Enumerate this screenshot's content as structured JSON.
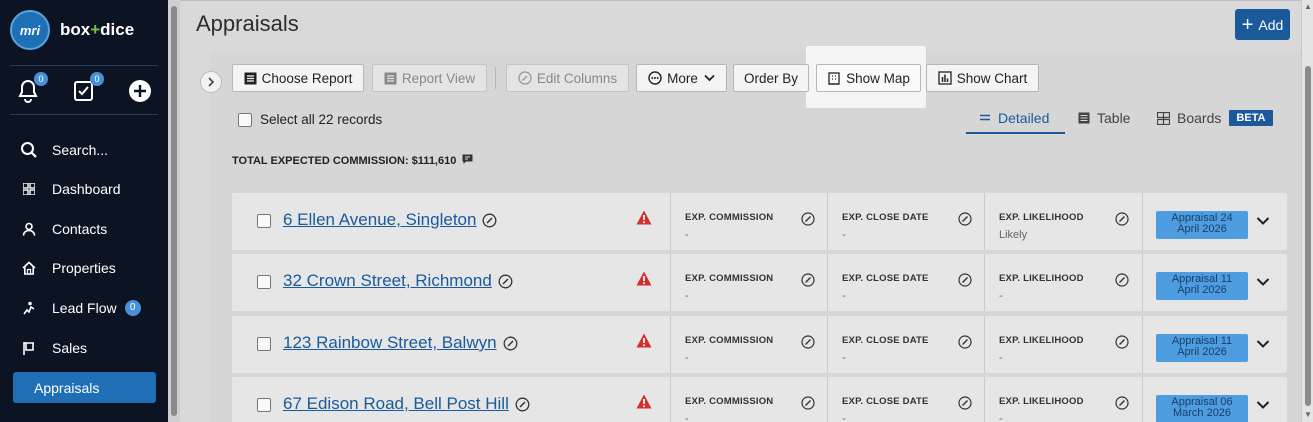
{
  "sidebar": {
    "logo_text": "mri",
    "brand_main": "box",
    "brand_plus": "+",
    "brand_tail": "dice",
    "quick": {
      "notifications_count": "0",
      "tasks_count": "0"
    },
    "items": [
      {
        "label": "Search..."
      },
      {
        "label": "Dashboard"
      },
      {
        "label": "Contacts"
      },
      {
        "label": "Properties"
      },
      {
        "label": "Lead Flow",
        "badge": "0"
      },
      {
        "label": "Sales"
      }
    ],
    "active_item": "Appraisals"
  },
  "header": {
    "title": "Appraisals",
    "add_label": "Add"
  },
  "toolbar": {
    "choose_report": "Choose Report",
    "report_view": "Report View",
    "edit_columns": "Edit Columns",
    "more": "More",
    "order_by": "Order By",
    "show_map": "Show Map",
    "show_chart": "Show Chart"
  },
  "select_all_label": "Select all 22 records",
  "views": {
    "detailed": "Detailed",
    "table": "Table",
    "boards": "Boards",
    "beta": "BETA"
  },
  "total_commission": "TOTAL EXPECTED COMMISSION: $111,610",
  "columns": {
    "commission": "EXP. COMMISSION",
    "close_date": "EXP. CLOSE DATE",
    "likelihood": "EXP. LIKELIHOOD"
  },
  "rows": [
    {
      "address": "6 Ellen Avenue, Singleton",
      "commission": "-",
      "close_date": "-",
      "likelihood": "Likely",
      "status_line1": "Appraisal 24",
      "status_line2": "April 2026"
    },
    {
      "address": "32 Crown Street, Richmond",
      "commission": "-",
      "close_date": "-",
      "likelihood": "-",
      "status_line1": "Appraisal 11",
      "status_line2": "April 2026"
    },
    {
      "address": "123 Rainbow Street, Balwyn",
      "commission": "-",
      "close_date": "-",
      "likelihood": "-",
      "status_line1": "Appraisal 11",
      "status_line2": "April 2026"
    },
    {
      "address": "67 Edison Road, Bell Post Hill",
      "commission": "-",
      "close_date": "-",
      "likelihood": "-",
      "status_line1": "Appraisal 06",
      "status_line2": "March 2026"
    }
  ],
  "colors": {
    "sidebar_bg": "#0c1424",
    "accent": "#1a5a9b",
    "status_badge": "#4d9de0",
    "warning": "#d32f2f"
  }
}
